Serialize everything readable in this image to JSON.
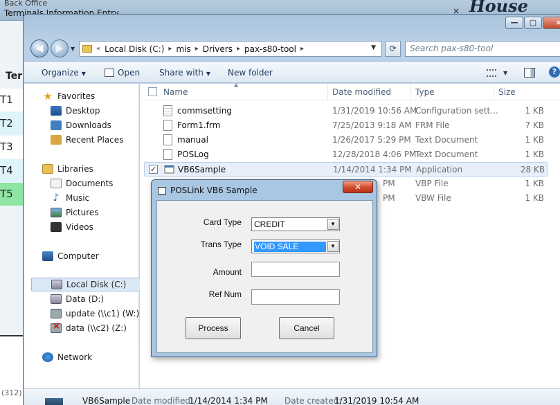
{
  "background_app": {
    "title_top": "Back Office",
    "title": "Terminals Information Entry",
    "brand_fragment": "House",
    "close_glyph": "×",
    "column_header": "Term",
    "rows": [
      "T1",
      "T2",
      "T3",
      "T4",
      "T5"
    ],
    "highlight_row": "T5",
    "count_label": "(312)"
  },
  "explorer": {
    "caption_buttons": {
      "minimize": "—",
      "maximize": "▢",
      "close": "×"
    },
    "address": {
      "prefix": "«",
      "crumbs": [
        "Local Disk (C:)",
        "mis",
        "Drivers",
        "pax-s80-tool"
      ]
    },
    "search_placeholder": "Search pax-s80-tool",
    "toolbar": {
      "organize": "Organize",
      "open": "Open",
      "share_with": "Share with",
      "new_folder": "New folder"
    },
    "nav": {
      "favorites": "Favorites",
      "desktop": "Desktop",
      "downloads": "Downloads",
      "recent_places": "Recent Places",
      "libraries": "Libraries",
      "documents": "Documents",
      "music": "Music",
      "pictures": "Pictures",
      "videos": "Videos",
      "computer": "Computer",
      "local_disk": "Local Disk (C:)",
      "data_d": "Data (D:)",
      "update_w": "update (\\\\c1) (W:)",
      "data_z": "data (\\\\c2) (Z:)",
      "network": "Network"
    },
    "columns": {
      "name": "Name",
      "date": "Date modified",
      "type": "Type",
      "size": "Size"
    },
    "files": [
      {
        "name": "commsetting",
        "date": "1/31/2019 10:56 AM",
        "type": "Configuration sett...",
        "size": "1 KB"
      },
      {
        "name": "Form1.frm",
        "date": "7/25/2013 9:18 AM",
        "type": "FRM File",
        "size": "7 KB"
      },
      {
        "name": "manual",
        "date": "1/26/2017 5:29 PM",
        "type": "Text Document",
        "size": "1 KB"
      },
      {
        "name": "POSLog",
        "date": "12/28/2018 4:06 PM",
        "type": "Text Document",
        "size": "1 KB"
      },
      {
        "name": "VB6Sample",
        "date": "1/14/2014 1:34 PM",
        "type": "Application",
        "size": "28 KB"
      },
      {
        "name": "",
        "date": "PM",
        "type": "VBP File",
        "size": "1 KB"
      },
      {
        "name": "",
        "date": "PM",
        "type": "VBW File",
        "size": "1 KB"
      }
    ],
    "details": {
      "name": "VB6Sample",
      "modified_label": "Date modified:",
      "modified_value": "1/14/2014 1:34 PM",
      "created_label": "Date created:",
      "created_value": "1/31/2019 10:54 AM"
    }
  },
  "dialog": {
    "title": "POSLink VB6 Sample",
    "close_glyph": "✕",
    "card_type_label": "Card Type",
    "card_type_value": "CREDIT",
    "trans_type_label": "Trans Type",
    "trans_type_value": "VOID SALE",
    "amount_label": "Amount",
    "ref_num_label": "Ref Num",
    "process_button": "Process",
    "cancel_button": "Cancel"
  }
}
